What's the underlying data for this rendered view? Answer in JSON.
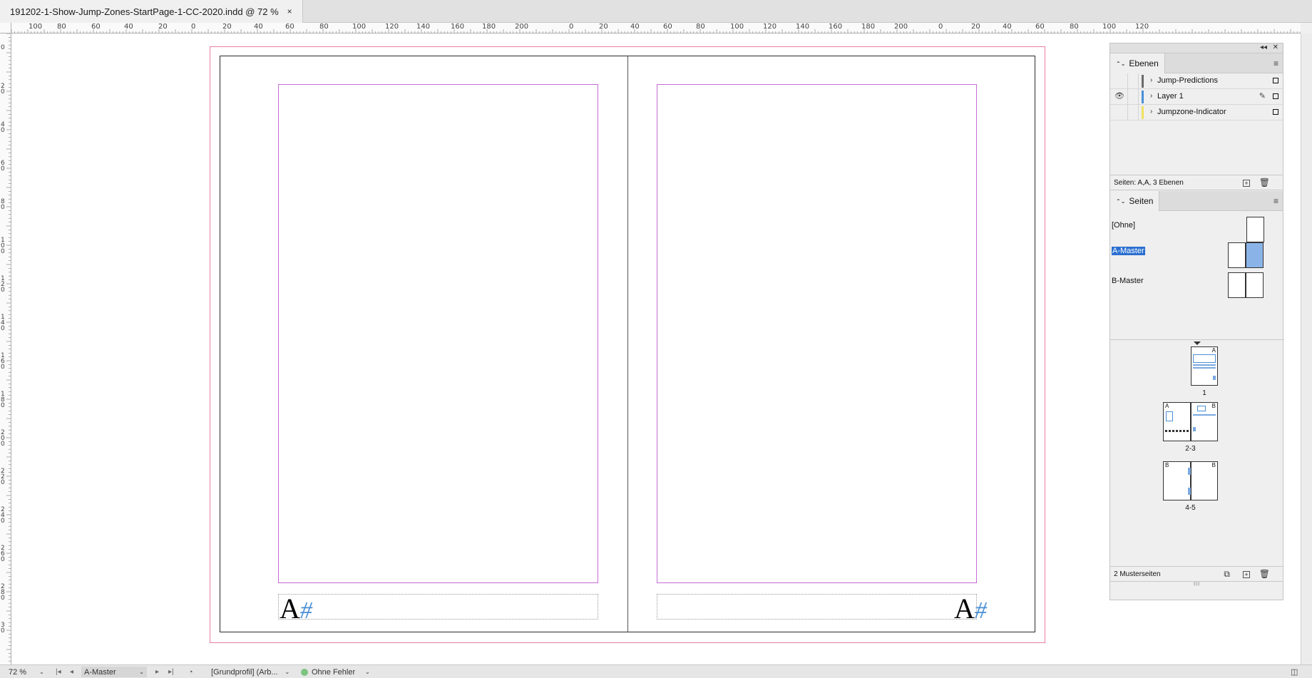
{
  "document": {
    "tab_title": "191202-1-Show-Jump-Zones-StartPage-1-CC-2020.indd @ 72 %",
    "close_glyph": "×"
  },
  "ruler": {
    "horizontal_labels": [
      "100",
      "80",
      "60",
      "40",
      "20",
      "0",
      "20",
      "40",
      "60",
      "80",
      "100",
      "120",
      "140",
      "160",
      "180",
      "200",
      "0",
      "20",
      "40",
      "60",
      "80",
      "100",
      "120",
      "140",
      "160",
      "180",
      "200",
      "0",
      "20",
      "40",
      "60",
      "80",
      "100",
      "120"
    ],
    "vertical_labels": [
      "0",
      "2 0",
      "4 0",
      "6 0",
      "8 0",
      "1 0 0",
      "1 2 0",
      "1 4 0",
      "1 6 0",
      "1 8 0",
      "2 0 0",
      "2 2 0",
      "2 4 0",
      "2 6 0",
      "2 8 0",
      "3 0"
    ]
  },
  "canvas": {
    "left_page_marker": "A",
    "right_page_marker": "A",
    "hash": "#"
  },
  "layers_panel": {
    "title": "Ebenen",
    "menu_icon": "≡",
    "collapse_icon": "◂◂",
    "close_icon": "✕",
    "layers": [
      {
        "name": "Jump-Predictions",
        "color": "#6b6b6b",
        "visible": false,
        "editable": false
      },
      {
        "name": "Layer 1",
        "color": "#4a8fd6",
        "visible": true,
        "editable": true
      },
      {
        "name": "Jumpzone-Indicator",
        "color": "#f0e060",
        "visible": false,
        "editable": false
      }
    ],
    "footer_text": "Seiten: A,A, 3 Ebenen"
  },
  "pages_panel": {
    "title": "Seiten",
    "masters": [
      {
        "name": "[Ohne]",
        "selected": false
      },
      {
        "name": "A-Master",
        "selected": true
      },
      {
        "name": "B-Master",
        "selected": false
      }
    ],
    "spreads": [
      {
        "label": "1",
        "left_master": "",
        "right_master": "A"
      },
      {
        "label": "2-3",
        "left_master": "A",
        "right_master": "B"
      },
      {
        "label": "4-5",
        "left_master": "B",
        "right_master": "B"
      }
    ],
    "footer_text": "2 Musterseiten"
  },
  "status_bar": {
    "zoom": "72 %",
    "page_select": "A-Master",
    "profile": "[Grundprofil] (Arb...",
    "preflight": "Ohne Fehler",
    "colors": {
      "preflight_ok": "#7cc47f"
    }
  }
}
